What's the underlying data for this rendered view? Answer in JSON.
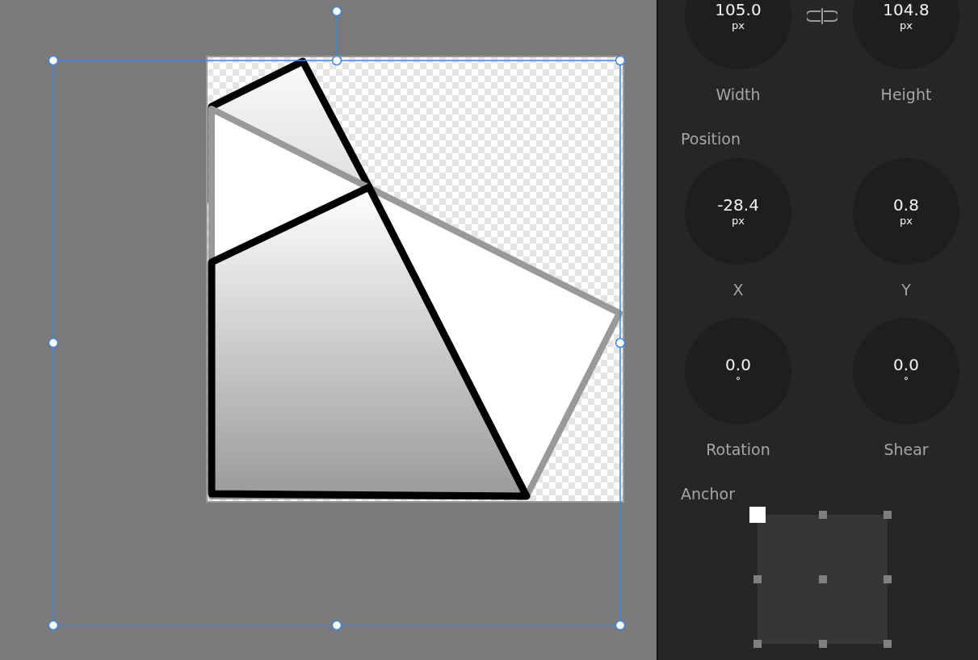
{
  "size": {
    "dials": [
      {
        "value": "105.0",
        "unit": "px",
        "label": "Width"
      },
      {
        "value": "104.8",
        "unit": "px",
        "label": "Height"
      }
    ]
  },
  "position": {
    "heading": "Position",
    "dials": [
      {
        "value": "-28.4",
        "unit": "px",
        "label": "X"
      },
      {
        "value": "0.8",
        "unit": "px",
        "label": "Y"
      }
    ]
  },
  "transform": {
    "dials": [
      {
        "value": "0.0",
        "unit": "°",
        "label": "Rotation"
      },
      {
        "value": "0.0",
        "unit": "°",
        "label": "Shear"
      }
    ]
  },
  "anchor": {
    "heading": "Anchor",
    "points": [
      {
        "selected": true
      },
      {
        "selected": false
      },
      {
        "selected": false
      },
      {
        "selected": false
      },
      {
        "selected": false
      },
      {
        "selected": false
      },
      {
        "selected": false
      },
      {
        "selected": false
      },
      {
        "selected": false
      }
    ]
  }
}
